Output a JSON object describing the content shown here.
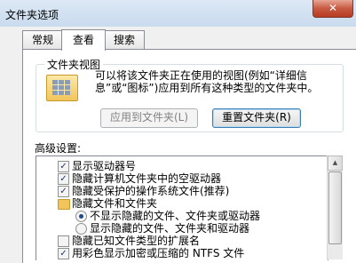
{
  "window": {
    "title": "文件夹选项",
    "close_glyph": "✕"
  },
  "tabs": [
    {
      "label": "常规",
      "active": false
    },
    {
      "label": "查看",
      "active": true
    },
    {
      "label": "搜索",
      "active": false
    }
  ],
  "folder_views": {
    "group_title": "文件夹视图",
    "icon": "folder-view-icon",
    "description": "可以将该文件夹正在使用的视图(例如“详细信息”或“图标”)应用到所有这种类型的文件夹中。",
    "apply_button": "应用到文件夹(L)",
    "reset_button": "重置文件夹(R)"
  },
  "advanced": {
    "label": "高级设置:",
    "items": [
      {
        "type": "checkbox",
        "checked": true,
        "label": "显示驱动器号"
      },
      {
        "type": "checkbox",
        "checked": true,
        "label": "隐藏计算机文件夹中的空驱动器"
      },
      {
        "type": "checkbox",
        "checked": true,
        "label": "隐藏受保护的操作系统文件(推荐)"
      },
      {
        "type": "folder",
        "label": "隐藏文件和文件夹"
      },
      {
        "type": "radio",
        "checked": true,
        "label": "不显示隐藏的文件、文件夹或驱动器"
      },
      {
        "type": "radio",
        "checked": false,
        "label": "显示隐藏的文件、文件夹和驱动器"
      },
      {
        "type": "checkbox",
        "checked": false,
        "label": "隐藏已知文件类型的扩展名"
      },
      {
        "type": "checkbox",
        "checked": true,
        "label": "用彩色显示加密或压缩的 NTFS 文件"
      }
    ],
    "check_glyph": "✓",
    "scroll_up_glyph": "▲"
  }
}
